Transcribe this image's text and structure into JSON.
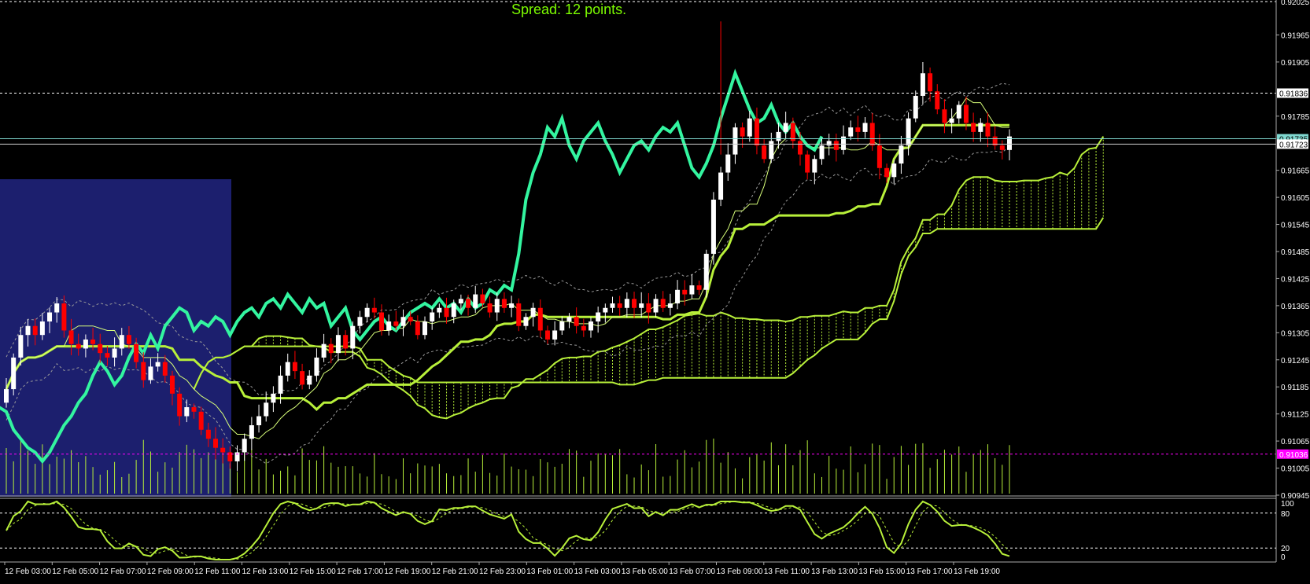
{
  "spread_text": "Spread: 12 points.",
  "colors": {
    "background": "#000000",
    "bull_candle": "#FFFFFF",
    "bear_candle": "#FF0000",
    "chikou": "#33F5A0",
    "kijun": "#B8F03A",
    "tenkan": "#D8FF7A",
    "cloud": "#B8F03A",
    "volume": "#B8F03A",
    "band": "#9A9A9A",
    "hline": "#FFFFFF",
    "bid_line": "#7FD8D0",
    "ask_line": "#CCCCCC",
    "magenta_line": "#FF00FF",
    "session_box": "#1C1F6E",
    "oscillator": "#B8F03A"
  },
  "chart_data": {
    "type": "candlestick",
    "symbol_title": "",
    "price_axis_ticks": [
      "0.91965",
      "0.91905",
      "0.91785",
      "0.91665",
      "0.91605",
      "0.91545",
      "0.91485",
      "0.91425",
      "0.91365",
      "0.91305",
      "0.91245",
      "0.91185",
      "0.91125",
      "0.91065",
      "0.91005",
      "0.90945"
    ],
    "top_partial_tick": "0.92025",
    "price_labels": {
      "hline": "0.91836",
      "bid": "0.91735",
      "ask": "0.91723",
      "magenta": "0.91036"
    },
    "time_labels": [
      "12 Feb 03:00",
      "12 Feb 05:00",
      "12 Feb 07:00",
      "12 Feb 09:00",
      "12 Feb 11:00",
      "12 Feb 13:00",
      "12 Feb 15:00",
      "12 Feb 17:00",
      "12 Feb 19:00",
      "12 Feb 21:00",
      "12 Feb 23:00",
      "13 Feb 01:00",
      "13 Feb 03:00",
      "13 Feb 05:00",
      "13 Feb 07:00",
      "13 Feb 09:00",
      "13 Feb 11:00",
      "13 Feb 13:00",
      "13 Feb 15:00",
      "13 Feb 17:00",
      "13 Feb 19:00"
    ],
    "y_range": [
      0.90945,
      0.92025
    ],
    "oscillator_ticks": [
      "100",
      "80",
      "20",
      "0"
    ],
    "oscillator_levels": [
      80,
      20
    ],
    "closes": [
      0.9118,
      0.9125,
      0.913,
      0.9132,
      0.913,
      0.9133,
      0.9135,
      0.9137,
      0.9131,
      0.9128,
      0.9127,
      0.9129,
      0.9128,
      0.9126,
      0.9125,
      0.9127,
      0.913,
      0.9128,
      0.9124,
      0.912,
      0.9123,
      0.9124,
      0.9121,
      0.9117,
      0.9112,
      0.9114,
      0.9113,
      0.9109,
      0.9107,
      0.9105,
      0.9104,
      0.9102,
      0.9104,
      0.9107,
      0.911,
      0.9112,
      0.9115,
      0.9117,
      0.9121,
      0.9124,
      0.9122,
      0.9119,
      0.9121,
      0.9125,
      0.9128,
      0.9126,
      0.913,
      0.9127,
      0.9132,
      0.9134,
      0.9136,
      0.9135,
      0.9131,
      0.9133,
      0.9132,
      0.9134,
      0.9133,
      0.913,
      0.9133,
      0.9135,
      0.9136,
      0.9134,
      0.9137,
      0.9138,
      0.9136,
      0.9139,
      0.9137,
      0.9135,
      0.9138,
      0.9136,
      0.9137,
      0.9132,
      0.9134,
      0.9136,
      0.9131,
      0.9129,
      0.9131,
      0.9133,
      0.9134,
      0.9132,
      0.9131,
      0.9133,
      0.9135,
      0.9136,
      0.9137,
      0.9136,
      0.9138,
      0.9136,
      0.9137,
      0.9135,
      0.9138,
      0.9136,
      0.9137,
      0.914,
      0.9139,
      0.9141,
      0.914,
      0.9148,
      0.916,
      0.9166,
      0.917,
      0.9176,
      0.9174,
      0.9178,
      0.9172,
      0.9169,
      0.9173,
      0.9175,
      0.9177,
      0.9173,
      0.917,
      0.9166,
      0.9169,
      0.9172,
      0.9173,
      0.9171,
      0.9174,
      0.9176,
      0.9175,
      0.9177,
      0.9172,
      0.9167,
      0.9165,
      0.9168,
      0.9172,
      0.9178,
      0.9183,
      0.9188,
      0.9184,
      0.918,
      0.9177,
      0.9178,
      0.9181,
      0.9177,
      0.9175,
      0.9177,
      0.9174,
      0.9172,
      0.9171,
      0.9174
    ]
  }
}
